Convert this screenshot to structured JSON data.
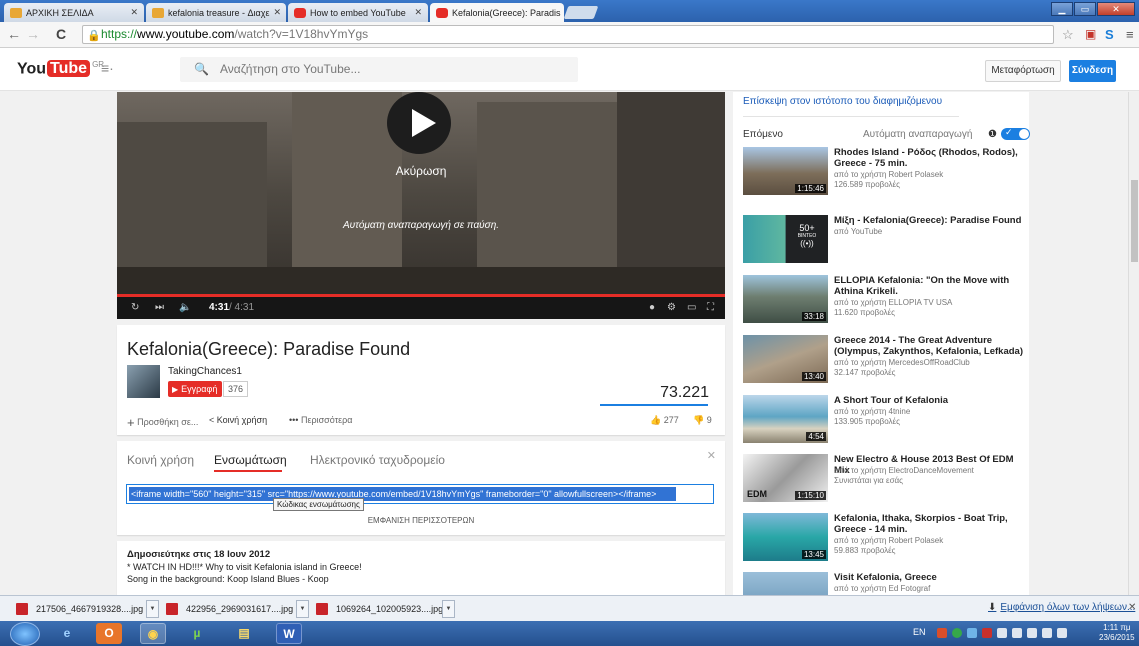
{
  "browser": {
    "tabs": [
      {
        "label": "ΑΡΧΙΚΗ ΣΕΛΙΔΑ",
        "favicon": "home-icon"
      },
      {
        "label": "kefalonia treasure - Διαχε",
        "favicon": "home-icon"
      },
      {
        "label": "How to embed YouTube",
        "favicon": "youtube-icon"
      },
      {
        "label": "Kefalonia(Greece): Paradis",
        "favicon": "youtube-icon",
        "active": true
      }
    ],
    "url_scheme": "https://",
    "url_host": "www.youtube.com",
    "url_path": "/watch?v=1V18hvYmYgs"
  },
  "youtube": {
    "logo_you": "You",
    "logo_tube": "Tube",
    "region": "GR",
    "search_placeholder": "Αναζήτηση στο YouTube...",
    "upload_label": "Μεταφόρτωση",
    "signin_label": "Σύνδεση",
    "accent": "#e52d27",
    "link_blue": "#1b7fe1"
  },
  "player": {
    "cancel_label": "Ακύρωση",
    "autoplay_paused": "Αυτόματη αναπαραγωγή σε παύση.",
    "time_current": "4:31",
    "time_total": " / 4:31"
  },
  "video": {
    "title": "Kefalonia(Greece): Paradise Found",
    "channel": "TakingChances1",
    "subscribe_label": "Εγγραφή",
    "subscriber_count": "376",
    "views": "73.221",
    "actions": {
      "add_to": "Προσθήκη σε...",
      "share": "Κοινή χρήση",
      "more": "Περισσότερα"
    },
    "likes": "277",
    "dislikes": "9"
  },
  "share": {
    "tabs": [
      "Κοινή χρήση",
      "Ενσωμάτωση",
      "Ηλεκτρονικό ταχυδρομείο"
    ],
    "active_tab": "Ενσωμάτωση",
    "embed_code": "<iframe width=\"560\" height=\"315\" src=\"https://www.youtube.com/embed/1V18hvYmYgs\" frameborder=\"0\" allowfullscreen></iframe>",
    "tooltip": "Κώδικας ενσωμάτωσης",
    "show_more": "ΕΜΦΑΝΙΣΗ ΠΕΡΙΣΣΟΤΕΡΩΝ"
  },
  "description": {
    "published": "Δημοσιεύτηκε στις 18 Ιουν 2012",
    "line1": "* WATCH IN HD!!!* Why to visit Kefalonia island in Greece!",
    "line2": "Song in the background: Koop Island Blues - Koop"
  },
  "sidebar": {
    "ad_link": "Επίσκεψη στον ιστότοπο του διαφημιζόμενου",
    "next_label": "Επόμενο",
    "autoplay_label": "Αυτόματη αναπαραγωγή",
    "autoplay_on": true,
    "items": [
      {
        "title": "Rhodes Island - Ρόδος (Rhodos, Rodos), Greece - 75 min.",
        "meta1": "από το χρήστη Robert Polasek",
        "meta2": "126.589 προβολές",
        "duration": "1:15:46"
      },
      {
        "title": "Μίξη - Kefalonia(Greece): Paradise Found",
        "meta1": "από YouTube",
        "meta2": "",
        "duration": "",
        "mix_count": "50+",
        "mix_label": "ΒΙΝΤΕΟ"
      },
      {
        "title": "ELLOPIA Kefalonia: \"On the Move with Athina Krikeli.",
        "meta1": "από το χρήστη ELLOPIA TV USA",
        "meta2": "11.620 προβολές",
        "duration": "33:18"
      },
      {
        "title": "Greece 2014 - The Great Adventure (Olympus, Zakynthos, Kefalonia, Lefkada)",
        "meta1": "από το χρήστη MercedesOffRoadClub",
        "meta2": "32.147 προβολές",
        "duration": "13:40"
      },
      {
        "title": "A Short Tour of Kefalonia",
        "meta1": "από το χρήστη 4tnine",
        "meta2": "133.905 προβολές",
        "duration": "4:54"
      },
      {
        "title": "New Electro & House 2013 Best Of EDM Mix",
        "meta1": "από το χρήστη ElectroDanceMovement",
        "meta2": "Συνιστάται για εσάς",
        "duration": "1:15:10",
        "thumb_text": "EDM"
      },
      {
        "title": "Kefalonia, Ithaka, Skorpios - Boat Trip, Greece - 14 min.",
        "meta1": "από το χρήστη Robert Polasek",
        "meta2": "59.883 προβολές",
        "duration": "13:45"
      },
      {
        "title": "Visit Kefalonia, Greece",
        "meta1": "από το χρήστη Ed Fotograf",
        "meta2": "",
        "duration": ""
      }
    ]
  },
  "downloads": {
    "items": [
      "217506_4667919328....jpg",
      "422956_2969031617....jpg",
      "1069264_102005923....jpg"
    ],
    "show_all": "Εμφάνιση όλων των λήψεων..."
  },
  "taskbar": {
    "lang": "EN",
    "time": "1:11 πμ",
    "date": "23/6/2015"
  }
}
